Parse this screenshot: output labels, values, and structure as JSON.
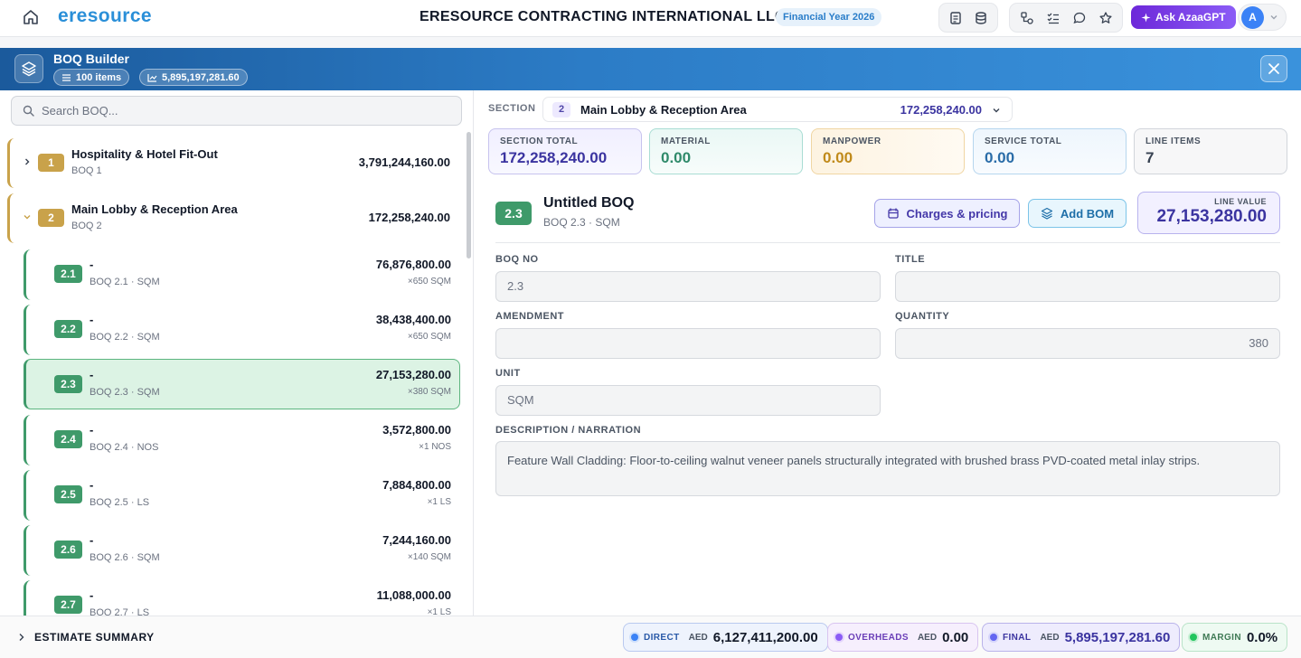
{
  "app": {
    "logo": "eresource",
    "company": "ERESOURCE CONTRACTING INTERNATIONAL LLC",
    "financial_year": "Financial Year 2026",
    "ask_label": "Ask AzaaGPT",
    "avatar_initial": "A"
  },
  "builder": {
    "title": "BOQ Builder",
    "items_chip": "100 items",
    "total_chip": "5,895,197,281.60"
  },
  "search": {
    "placeholder": "Search BOQ..."
  },
  "tree": {
    "sections": [
      {
        "num": "1",
        "title": "Hospitality & Hotel Fit-Out",
        "sub": "BOQ 1",
        "amount": "3,791,244,160.00",
        "expanded": false
      },
      {
        "num": "2",
        "title": "Main Lobby & Reception Area",
        "sub": "BOQ 2",
        "amount": "172,258,240.00",
        "expanded": true
      }
    ],
    "items": [
      {
        "num": "2.1",
        "title": "-",
        "sub": "BOQ 2.1 · SQM",
        "amount": "76,876,800.00",
        "qty": "×650 SQM"
      },
      {
        "num": "2.2",
        "title": "-",
        "sub": "BOQ 2.2 · SQM",
        "amount": "38,438,400.00",
        "qty": "×650 SQM"
      },
      {
        "num": "2.3",
        "title": "-",
        "sub": "BOQ 2.3 · SQM",
        "amount": "27,153,280.00",
        "qty": "×380 SQM"
      },
      {
        "num": "2.4",
        "title": "-",
        "sub": "BOQ 2.4 · NOS",
        "amount": "3,572,800.00",
        "qty": "×1 NOS"
      },
      {
        "num": "2.5",
        "title": "-",
        "sub": "BOQ 2.5 · LS",
        "amount": "7,884,800.00",
        "qty": "×1 LS"
      },
      {
        "num": "2.6",
        "title": "-",
        "sub": "BOQ 2.6 · SQM",
        "amount": "7,244,160.00",
        "qty": "×140 SQM"
      },
      {
        "num": "2.7",
        "title": "-",
        "sub": "BOQ 2.7 · LS",
        "amount": "11,088,000.00",
        "qty": "×1 LS"
      }
    ]
  },
  "section_bar": {
    "label": "SECTION",
    "num": "2",
    "title": "Main Lobby & Reception Area",
    "amount": "172,258,240.00"
  },
  "stats": [
    {
      "label": "SECTION TOTAL",
      "value": "172,258,240.00",
      "color": "#3b34a0"
    },
    {
      "label": "MATERIAL",
      "value": "0.00",
      "color": "#2f8a6a"
    },
    {
      "label": "MANPOWER",
      "value": "0.00",
      "color": "#c08a1a"
    },
    {
      "label": "SERVICE TOTAL",
      "value": "0.00",
      "color": "#2a6ca8"
    },
    {
      "label": "LINE ITEMS",
      "value": "7",
      "color": "#374151"
    }
  ],
  "detail": {
    "num": "2.3",
    "title": "Untitled BOQ",
    "sub": "BOQ 2.3 · SQM",
    "charges_label": "Charges & pricing",
    "bom_label": "Add BOM",
    "line_value_label": "LINE VALUE",
    "line_value": "27,153,280.00"
  },
  "form": {
    "boq_no_label": "BOQ NO",
    "boq_no": "2.3",
    "title_label": "TITLE",
    "title": "",
    "amendment_label": "AMENDMENT",
    "amendment": "",
    "quantity_label": "QUANTITY",
    "quantity": "380",
    "unit_label": "UNIT",
    "unit": "SQM",
    "description_label": "DESCRIPTION / NARRATION",
    "description": "Feature Wall Cladding: Floor-to-ceiling walnut veneer panels structurally integrated with brushed brass PVD-coated metal inlay strips."
  },
  "summary": {
    "label": "ESTIMATE SUMMARY",
    "currency": "AED",
    "direct_label": "DIRECT",
    "direct_value": "6,127,411,200.00",
    "overheads_label": "OVERHEADS",
    "overheads_value": "0.00",
    "final_label": "FINAL",
    "final_value": "5,895,197,281.60",
    "margin_label": "MARGIN",
    "margin_value": "0.0%"
  }
}
